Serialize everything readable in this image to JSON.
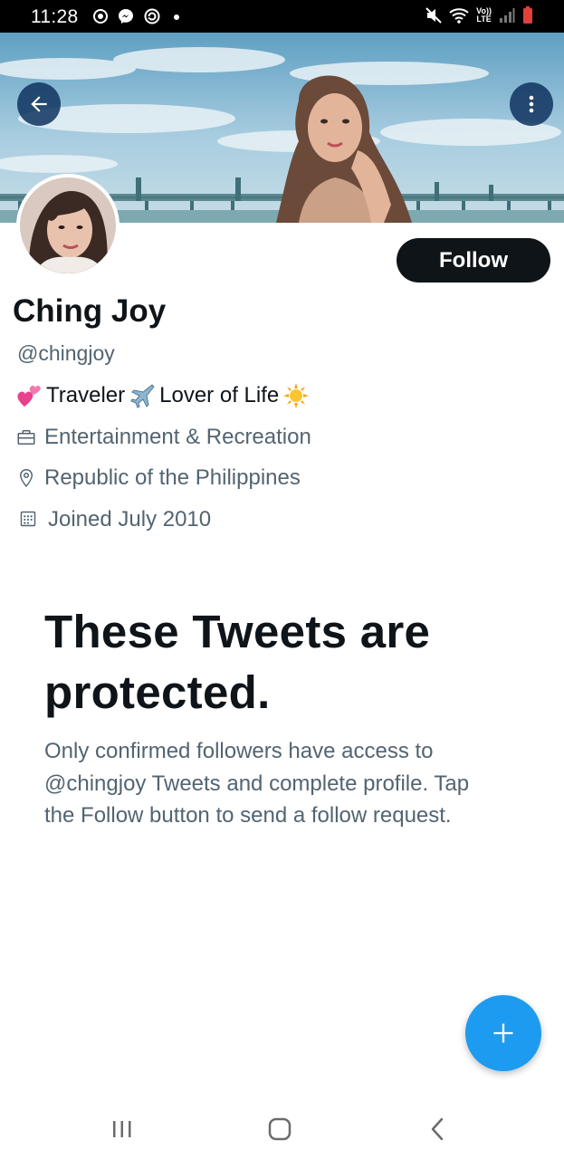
{
  "status_bar": {
    "time": "11:28",
    "network_label": "LTE",
    "icons_left": [
      "camera-notification-icon",
      "messenger-icon",
      "sync-icon",
      "dot-icon"
    ],
    "icons_right": [
      "mute-icon",
      "wifi-icon",
      "volte-icon",
      "signal-icon",
      "battery-icon"
    ]
  },
  "header": {
    "back_icon": "arrow-left-icon",
    "more_icon": "more-vertical-icon"
  },
  "profile": {
    "display_name": "Ching Joy",
    "handle": "@chingjoy",
    "follow_label": "Follow",
    "bio": {
      "part1": "Traveler",
      "part2": "Lover of Life",
      "emojis": [
        "two-hearts-emoji",
        "airplane-emoji",
        "sun-emoji"
      ]
    },
    "category": "Entertainment & Recreation",
    "location": "Republic of the Philippines",
    "joined": "Joined July 2010"
  },
  "protected": {
    "title": "These Tweets are protected.",
    "body": "Only confirmed followers have access to @chingjoy Tweets and complete profile. Tap the Follow button to send a follow request."
  },
  "fab": {
    "icon": "plus-icon"
  },
  "nav": {
    "icons": [
      "recents-icon",
      "home-icon",
      "back-icon"
    ]
  },
  "colors": {
    "accent": "#1d9bf0",
    "text_primary": "#0f1419",
    "text_secondary": "#536471",
    "header_button_bg": "#0f325f"
  }
}
